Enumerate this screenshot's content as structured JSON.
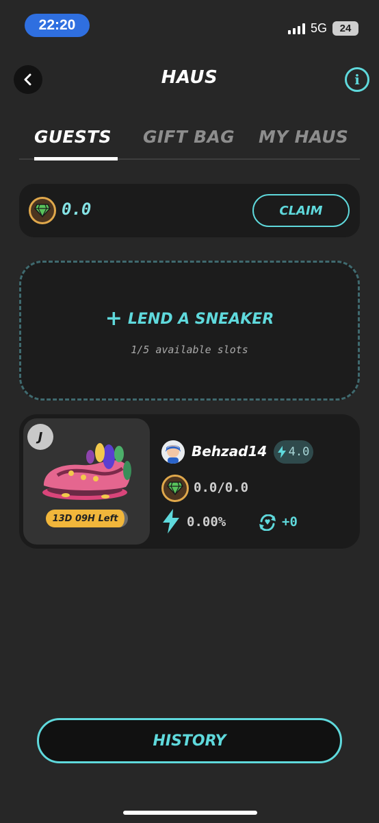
{
  "status_bar": {
    "time": "22:20",
    "network": "5G",
    "battery": "24"
  },
  "header": {
    "title": "HAUS"
  },
  "tabs": [
    {
      "label": "GUESTS",
      "active": true
    },
    {
      "label": "GIFT BAG",
      "active": false
    },
    {
      "label": "MY HAUS",
      "active": false
    }
  ],
  "balance": {
    "value": "0.0",
    "claim_label": "CLAIM"
  },
  "lend": {
    "title": "LEND A SNEAKER",
    "plus": "+",
    "subtitle": "1/5 available slots"
  },
  "guest": {
    "type_badge": "J",
    "time_left": "13D 09H Left",
    "username": "Behzad14",
    "level": "4.0",
    "earnings": "0.0/0.0",
    "percent": "0.00%",
    "recycle": "+0"
  },
  "history_label": "HISTORY",
  "colors": {
    "accent": "#5fd9dc",
    "background": "#272727",
    "card": "#1b1b1b",
    "badge_yellow": "#f1b63b"
  },
  "icons": [
    "back-arrow-icon",
    "info-icon",
    "gem-icon",
    "bolt-icon",
    "recycle-icon"
  ]
}
